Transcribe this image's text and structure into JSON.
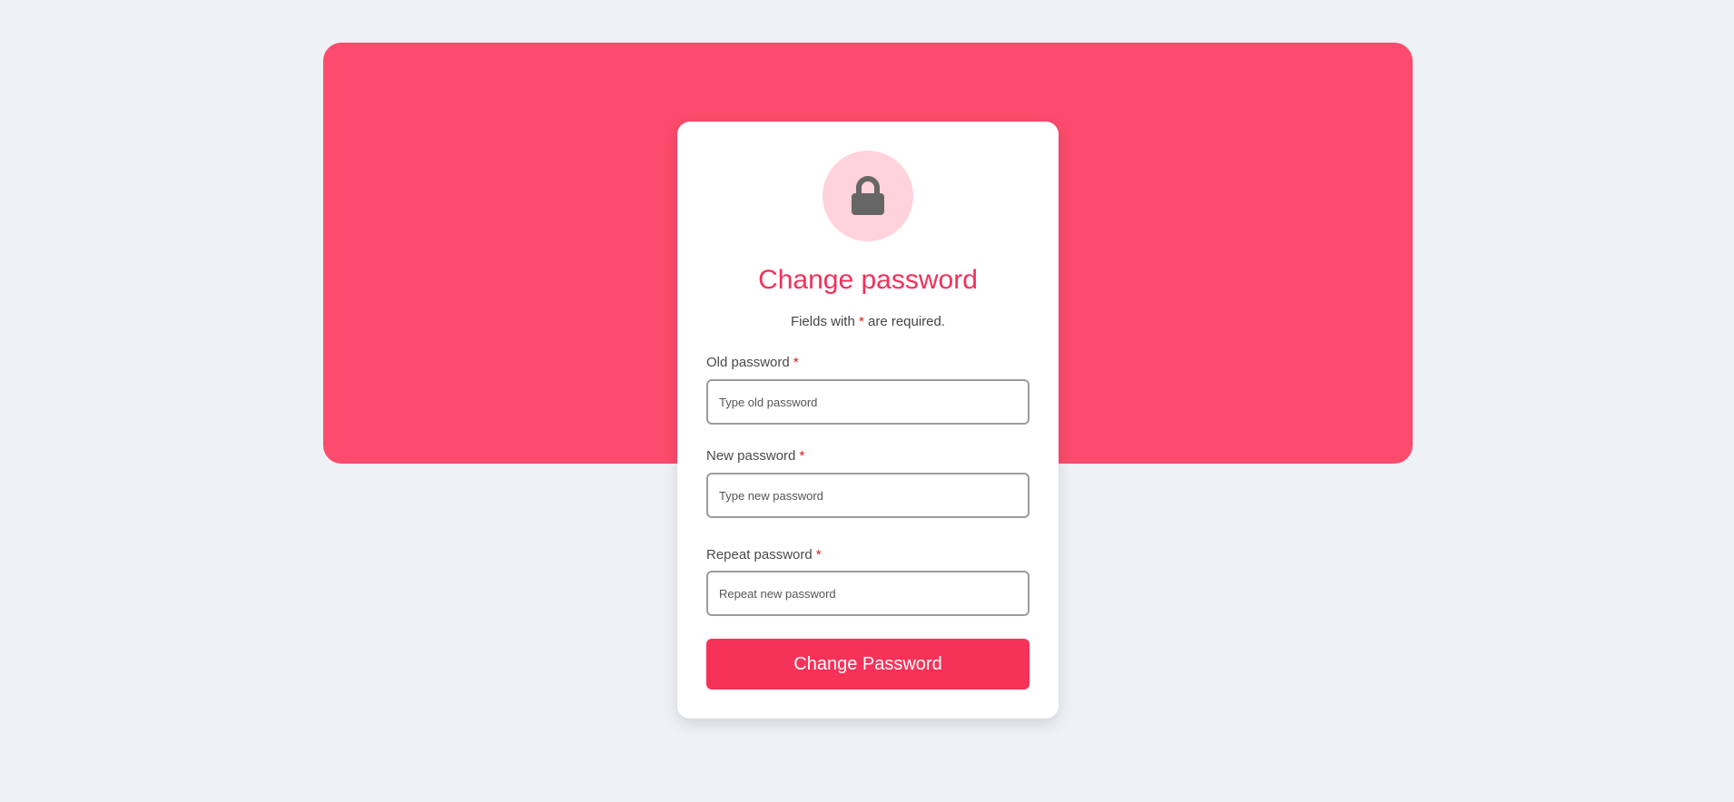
{
  "accent_color": "#fc4b6c",
  "button_color": "#f73258",
  "title_color": "#f3305a",
  "icon": "lock-icon",
  "form": {
    "title": "Change password",
    "subtitle_prefix": "Fields with",
    "required_mark": "*",
    "subtitle_suffix": "are required.",
    "fields": [
      {
        "label": "Old password",
        "placeholder": "Type old password",
        "value": ""
      },
      {
        "label": "New password",
        "placeholder": "Type new password",
        "value": ""
      },
      {
        "label": "Repeat password",
        "placeholder": "Repeat new password",
        "value": ""
      }
    ],
    "submit_label": "Change Password"
  }
}
